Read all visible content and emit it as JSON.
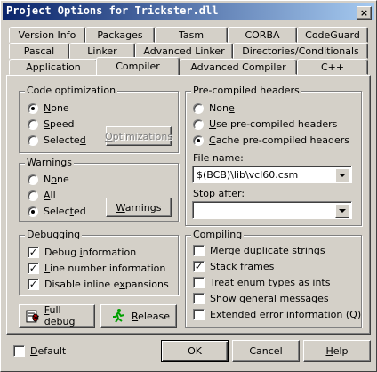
{
  "window": {
    "title": "Project Options for Trickster.dll",
    "close_glyph": "×"
  },
  "tabs": {
    "row1": [
      "Version Info",
      "Packages",
      "Tasm",
      "CORBA",
      "CodeGuard"
    ],
    "row2": [
      "Pascal",
      "Linker",
      "Advanced Linker",
      "Directories/Conditionals"
    ],
    "row3": [
      "Application",
      "Compiler",
      "Advanced Compiler",
      "C++"
    ],
    "active": "Compiler"
  },
  "code_optimization": {
    "title": "Code optimization",
    "options": [
      {
        "pre": "",
        "key": "N",
        "post": "one",
        "checked": true
      },
      {
        "pre": "",
        "key": "S",
        "post": "peed",
        "checked": false
      },
      {
        "pre": "Selecte",
        "key": "d",
        "post": "",
        "checked": false
      }
    ],
    "optimizations_button": {
      "pre": "",
      "key": "O",
      "post": "ptimizations",
      "enabled": false
    }
  },
  "warnings": {
    "title": "Warnings",
    "options": [
      {
        "pre": "N",
        "key": "o",
        "post": "ne",
        "checked": false
      },
      {
        "pre": "",
        "key": "A",
        "post": "ll",
        "checked": false
      },
      {
        "pre": "Selec",
        "key": "t",
        "post": "ed",
        "checked": true
      }
    ],
    "warnings_button": {
      "pre": "",
      "key": "W",
      "post": "arnings"
    }
  },
  "debugging": {
    "title": "Debugging",
    "options": [
      {
        "pre": "Debug ",
        "key": "i",
        "post": "nformation",
        "checked": true
      },
      {
        "pre": "",
        "key": "L",
        "post": "ine number information",
        "checked": true
      },
      {
        "pre": "Disable inline e",
        "key": "x",
        "post": "pansions",
        "checked": true
      }
    ]
  },
  "full_debug_button": {
    "pre": "",
    "key": "F",
    "post": "ull debug",
    "icon": "bug-icon"
  },
  "release_button": {
    "pre": "",
    "key": "R",
    "post": "elease",
    "icon": "running-man-icon"
  },
  "precompiled_headers": {
    "title": "Pre-compiled headers",
    "options": [
      {
        "pre": "Non",
        "key": "e",
        "post": "",
        "checked": false
      },
      {
        "pre": "",
        "key": "U",
        "post": "se pre-compiled headers",
        "checked": false
      },
      {
        "pre": "",
        "key": "C",
        "post": "ache pre-compiled headers",
        "checked": true
      }
    ],
    "file_name_label": "File name:",
    "file_name_value": "$(BCB)\\lib\\vcl60.csm",
    "stop_after_label": "Stop after:",
    "stop_after_value": ""
  },
  "compiling": {
    "title": "Compiling",
    "options": [
      {
        "pre": "",
        "key": "M",
        "post": "erge duplicate strings",
        "checked": false
      },
      {
        "pre": "Stac",
        "key": "k",
        "post": " frames",
        "checked": true
      },
      {
        "pre": "Treat enum ",
        "key": "t",
        "post": "ypes as ints",
        "checked": false
      },
      {
        "pre": "Show general messages",
        "key": "",
        "post": "",
        "checked": false
      },
      {
        "pre": "Extended error information (",
        "key": "Q",
        "post": ")",
        "checked": false
      }
    ]
  },
  "footer": {
    "default": {
      "pre": "",
      "key": "D",
      "post": "efault",
      "checked": false
    },
    "ok_label": "OK",
    "cancel_label": "Cancel",
    "help": {
      "pre": "",
      "key": "H",
      "post": "elp"
    }
  }
}
